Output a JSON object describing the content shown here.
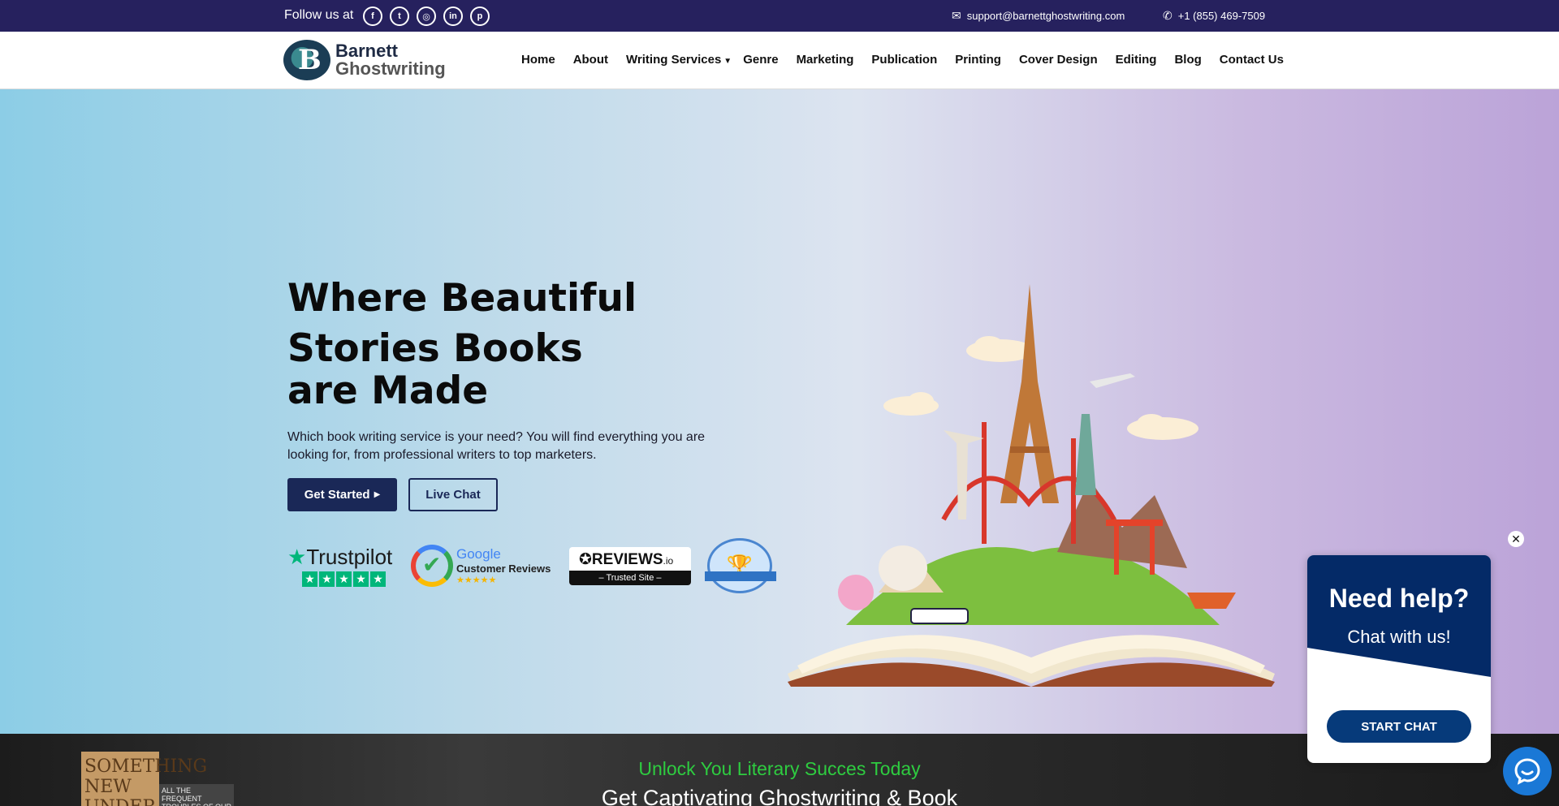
{
  "topbar": {
    "follow_label": "Follow us at",
    "social": [
      {
        "icon": "facebook-icon",
        "glyph": "f"
      },
      {
        "icon": "twitter-icon",
        "glyph": "t"
      },
      {
        "icon": "instagram-icon",
        "glyph": "◎"
      },
      {
        "icon": "linkedin-icon",
        "glyph": "in"
      },
      {
        "icon": "pinterest-icon",
        "glyph": "p"
      }
    ],
    "email": "support@barnettghostwriting.com",
    "phone": "+1 (855) 469-7509"
  },
  "logo": {
    "line1": "Barnett",
    "line2": "Ghostwriting"
  },
  "nav": {
    "items": [
      "Home",
      "About",
      "Writing Services",
      "Genre",
      "Marketing",
      "Publication",
      "Printing",
      "Cover Design",
      "Editing",
      "Blog",
      "Contact Us"
    ]
  },
  "hero": {
    "title_line1": "Where Beautiful",
    "title_line2": "Stories Books",
    "title_line3": "are Made",
    "subtitle": "Which book writing service is your need? You will find everything you are looking for, from professional writers to top marketers.",
    "get_started": "Get Started",
    "live_chat": "Live Chat"
  },
  "badges": {
    "trustpilot": "Trustpilot",
    "google_1": "Google",
    "google_2": "Customer Reviews",
    "google_stars": "★★★★★",
    "reviews_name": "REVIEWS",
    "reviews_suffix": ".io",
    "reviews_trusted": "– Trusted Site –"
  },
  "strip": {
    "tagline": "Unlock You Literary Succes Today",
    "headline": "Get Captivating Ghostwriting & Book",
    "book_left": "SOMETHING NEW UNDER",
    "book_left2": "ALL THE FREQUENT TROUBLES OF OUR"
  },
  "chat": {
    "title": "Need help?",
    "subtitle": "Chat with us!",
    "button": "START CHAT"
  },
  "colors": {
    "topbar": "#26215e",
    "primary": "#1a2857",
    "chat": "#042a67",
    "accent_green": "#2ecc40"
  }
}
